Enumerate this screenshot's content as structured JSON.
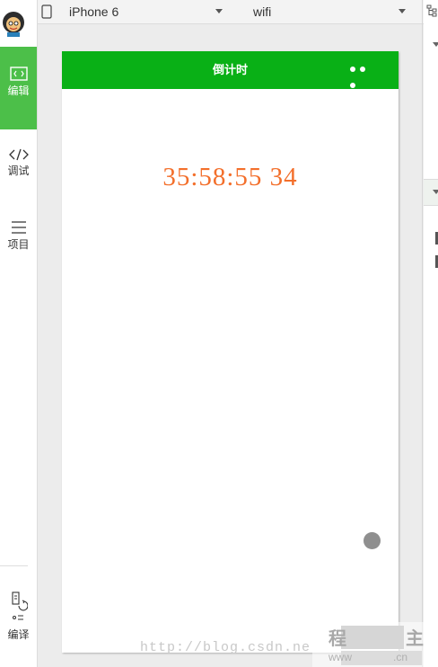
{
  "sidebar": {
    "items": [
      {
        "label": "编辑",
        "icon": "code-box-icon",
        "active": true
      },
      {
        "label": "调试",
        "icon": "code-brackets-icon",
        "active": false
      },
      {
        "label": "项目",
        "icon": "hamburger-menu-icon",
        "active": false
      },
      {
        "label": "编译",
        "icon": "compile-icon",
        "active": false
      }
    ]
  },
  "toolbar": {
    "device": "iPhone 6",
    "network": "wifi"
  },
  "phone": {
    "nav_title": "倒计时",
    "countdown": "35:58:55 34"
  },
  "watermark": {
    "url": "http://blog.csdn.ne",
    "brand_left": "程",
    "brand_right": "主",
    "sub_left": "www",
    "sub_right": ".cn"
  },
  "colors": {
    "nav_green": "#09b016",
    "sidebar_active_green": "#4cbf49",
    "countdown_orange": "#f36f2b"
  }
}
